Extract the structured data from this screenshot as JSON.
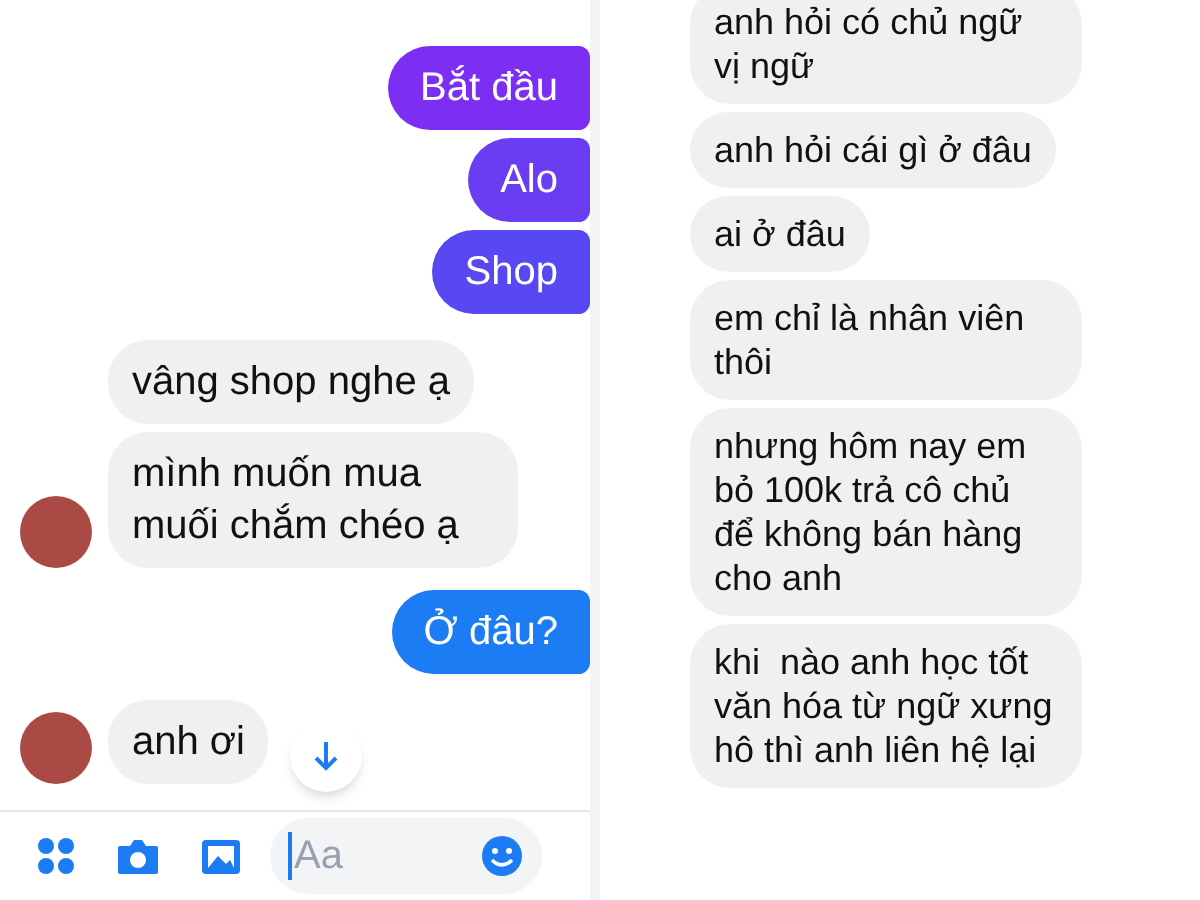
{
  "left_chat": {
    "messages": [
      {
        "kind": "outgoing",
        "text": "Bắt đầu",
        "color": "#7c2ff3"
      },
      {
        "kind": "outgoing",
        "text": "Alo",
        "color": "#6a3cf2"
      },
      {
        "kind": "outgoing",
        "text": "Shop",
        "color": "#5848f2"
      },
      {
        "kind": "incoming",
        "text": "vâng shop nghe ạ",
        "avatar": false
      },
      {
        "kind": "incoming",
        "text": "mình muốn mua muối chắm chéo ạ",
        "avatar": true
      },
      {
        "kind": "outgoing",
        "text": "Ở đâu?",
        "color": "#1b7cf4"
      },
      {
        "kind": "incoming",
        "text": "anh ơi",
        "avatar": true
      }
    ],
    "composer": {
      "placeholder": "Aa"
    }
  },
  "right_chat": {
    "messages": [
      {
        "kind": "incoming",
        "text": "anh hỏi có chủ ngữ vị ngữ"
      },
      {
        "kind": "incoming",
        "text": "anh hỏi cái gì ở đâu"
      },
      {
        "kind": "incoming",
        "text": "ai ở đâu"
      },
      {
        "kind": "incoming",
        "text": "em chỉ là nhân viên thôi"
      },
      {
        "kind": "incoming",
        "text": "nhưng hôm nay em bỏ 100k trả cô chủ để không bán hàng cho anh"
      },
      {
        "kind": "incoming",
        "text": "khi  nào anh học tốt văn hóa từ ngữ xưng hô thì anh liên hệ lại"
      }
    ]
  }
}
